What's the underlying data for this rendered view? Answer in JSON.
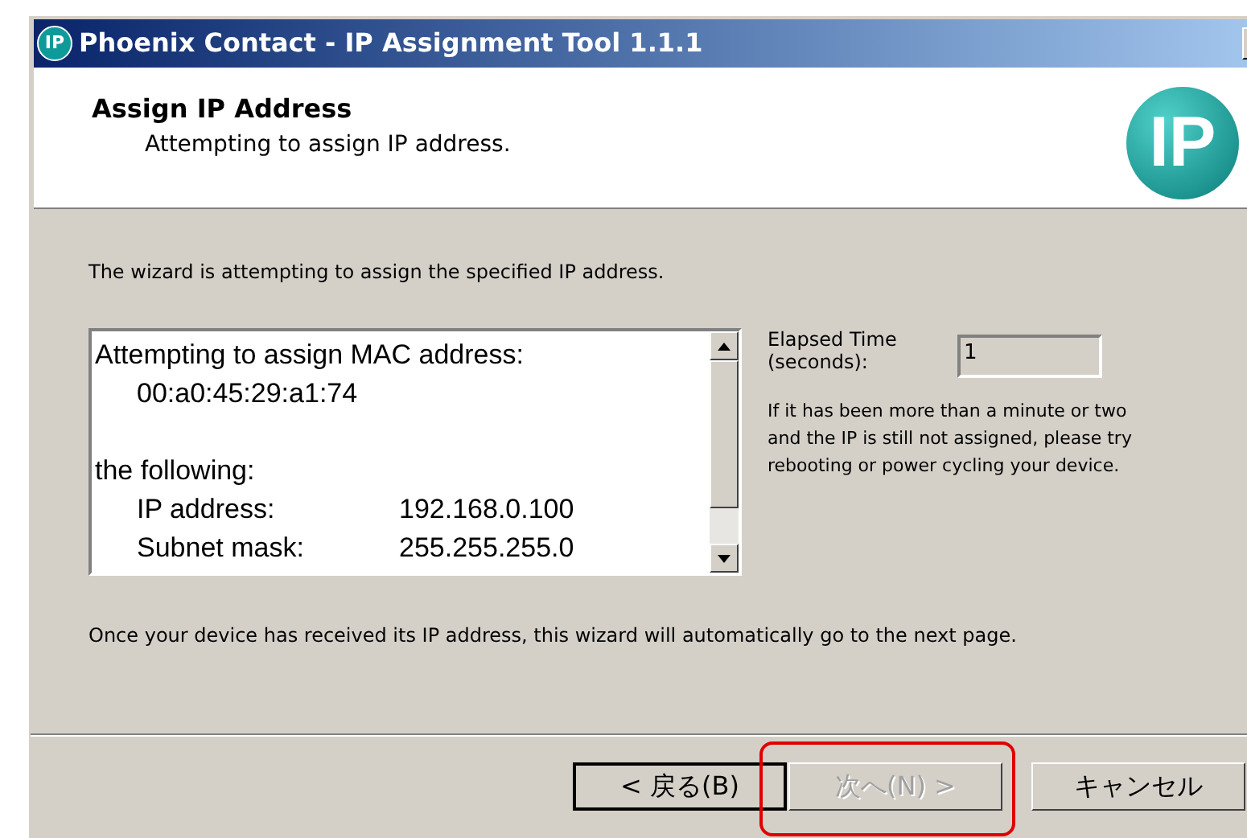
{
  "window": {
    "title": "Phoenix Contact - IP Assignment Tool 1.1.1",
    "app_icon_text": "IP"
  },
  "header": {
    "title": "Assign IP Address",
    "subtitle": "Attempting to assign IP address.",
    "logo_text": "IP"
  },
  "intro": "The wizard is attempting to assign the specified IP address.",
  "log": {
    "lines": [
      {
        "kind": "text",
        "text": "Attempting to assign MAC address:"
      },
      {
        "kind": "indented",
        "text": "00:a0:45:29:a1:74"
      },
      {
        "kind": "spacer"
      },
      {
        "kind": "text",
        "text": "the following:"
      },
      {
        "kind": "pair",
        "label": "IP address:",
        "value": "192.168.0.100"
      },
      {
        "kind": "pair",
        "label": "Subnet mask:",
        "value": "255.255.255.0"
      }
    ]
  },
  "elapsed": {
    "label": "Elapsed Time (seconds):",
    "value": "1"
  },
  "help": "If it has been more than a minute or two and the IP is still not assigned, please try rebooting or power cycling your device.",
  "footer_note": "Once your device has received its IP address, this wizard will automatically go to the next page.",
  "buttons": [
    {
      "label": "< 戻る(B)",
      "disabled": false,
      "default": true,
      "highlighted": false
    },
    {
      "label": "次へ(N) >",
      "disabled": true,
      "default": false,
      "highlighted": true
    },
    {
      "label": "キャンセル",
      "disabled": false,
      "default": false,
      "highlighted": false
    }
  ]
}
